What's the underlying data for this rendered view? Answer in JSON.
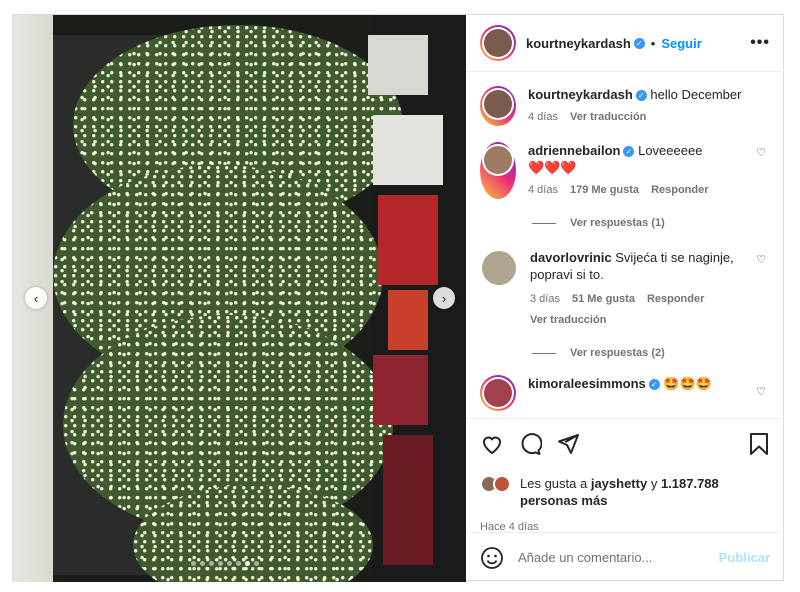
{
  "post": {
    "author": "kourtneykardash",
    "follow_label": "Seguir",
    "more_label": "•••",
    "caption": {
      "username": "kourtneykardash",
      "text": "hello December",
      "time": "4 días",
      "translate": "Ver traducción"
    },
    "comments": [
      {
        "username": "adriennebailon",
        "verified": true,
        "text": "Loveeeeee",
        "emoji": "❤️❤️❤️",
        "time": "4 días",
        "likes": "179 Me gusta",
        "reply": "Responder",
        "view_replies": "Ver respuestas (1)"
      },
      {
        "username": "davorlovrinic",
        "verified": false,
        "text": "Svijeća ti se naginje, popravi si to.",
        "time": "3 días",
        "likes": "51 Me gusta",
        "reply": "Responder",
        "translate": "Ver traducción",
        "view_replies": "Ver respuestas (2)"
      },
      {
        "username": "kimoraleesimmons",
        "verified": true,
        "emoji": "🤩🤩🤩"
      }
    ],
    "likes": {
      "prefix": "Les gusta a ",
      "user": "jayshetty",
      "middle": " y ",
      "count": "1.187.788 personas más"
    },
    "posted_ago": "Hace 4 días",
    "add_comment": {
      "placeholder": "Añade un comentario...",
      "publish": "Publicar"
    },
    "carousel": {
      "slides": 8,
      "active": 6
    }
  },
  "icons": {
    "verified": "verified-badge-icon",
    "like": "heart-icon",
    "comment": "comment-icon",
    "share": "send-icon",
    "save": "bookmark-icon",
    "emoji": "smiley-icon",
    "prev": "chevron-left-icon",
    "next": "chevron-right-icon"
  },
  "colors": {
    "accent": "#0095f6",
    "verified": "#3897f0",
    "heart": "#ed4956"
  }
}
